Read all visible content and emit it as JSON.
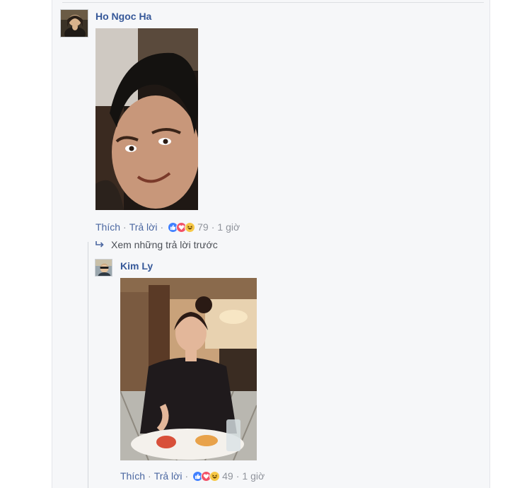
{
  "comments": [
    {
      "author": "Ho Ngoc Ha",
      "like_label": "Thích",
      "reply_label": "Trả lời",
      "reaction_icons": [
        "like-icon",
        "love-icon",
        "haha-icon"
      ],
      "reaction_count": "79",
      "time": "1 giờ"
    }
  ],
  "replies": {
    "view_previous_label": "Xem những trả lời trước",
    "items": [
      {
        "author": "Kim Ly",
        "like_label": "Thích",
        "reply_label": "Trả lời",
        "reaction_icons": [
          "like-icon",
          "love-icon",
          "haha-icon"
        ],
        "reaction_count": "49",
        "time": "1 giờ"
      }
    ]
  },
  "colors": {
    "link_blue": "#365899",
    "meta_gray": "#90949c",
    "panel_bg": "#f6f7f9",
    "like_blue": "#4080ff",
    "love_red": "#f25268",
    "haha_yellow": "#f7c846"
  }
}
